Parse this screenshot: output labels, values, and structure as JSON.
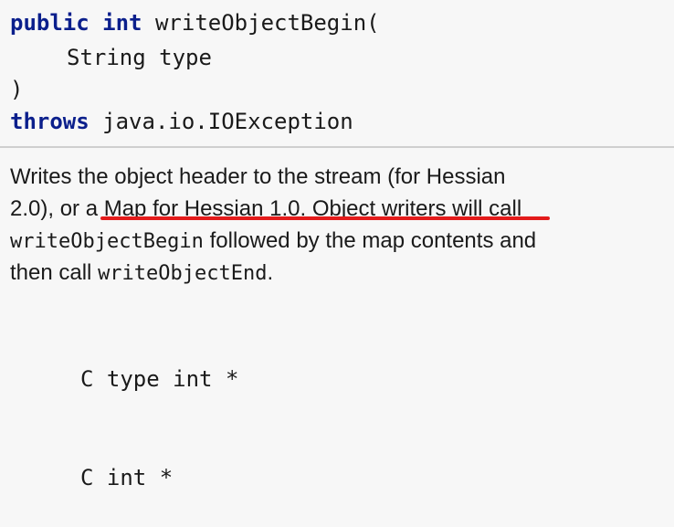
{
  "signature": {
    "modifier": "public",
    "return_type": "int",
    "method_name": "writeObjectBegin(",
    "param_type": "String",
    "param_name": "type",
    "close_paren": ")",
    "throws_keyword": "throws",
    "exception": "java.io.IOException"
  },
  "description": {
    "line1": "Writes the object header to the stream (for Hessian",
    "line2": "2.0), or a Map for Hessian 1.0. Object writers will call",
    "line3_code": "writeObjectBegin",
    "line3_text": " followed by the map contents and",
    "line4_text": "then call ",
    "line4_code": "writeObjectEnd",
    "line4_end": "."
  },
  "code_block": {
    "line1": "C type int *",
    "line2": "C int *"
  },
  "colors": {
    "keyword": "#0b1f8c",
    "annotation_underline": "#e31b1b",
    "background": "#f7f7f7"
  }
}
